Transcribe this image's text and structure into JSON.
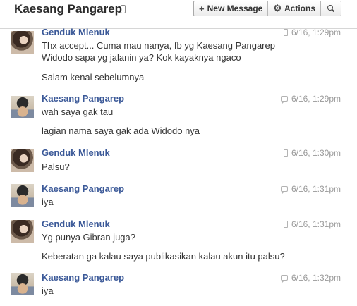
{
  "header": {
    "title": "Kaesang Pangarep",
    "new_message_label": "New Message",
    "actions_label": "Actions"
  },
  "messages": [
    {
      "author": "Genduk Mlenuk",
      "time": "6/16, 1:29pm",
      "via": "phone-icon",
      "lines": [
        "Thx accept... Cuma mau nanya, fb yg Kaesang Pangarep",
        "Widodo sapa yg jalanin ya? Kok kayaknya ngaco",
        "Salam kenal sebelumnya"
      ]
    },
    {
      "author": "Kaesang Pangarep",
      "time": "6/16, 1:29pm",
      "via": "chat-icon",
      "lines": [
        "wah saya gak tau",
        "lagian nama saya gak ada Widodo nya"
      ]
    },
    {
      "author": "Genduk Mlenuk",
      "time": "6/16, 1:30pm",
      "via": "phone-icon",
      "lines": [
        "Palsu?"
      ]
    },
    {
      "author": "Kaesang Pangarep",
      "time": "6/16, 1:31pm",
      "via": "chat-icon",
      "lines": [
        "iya"
      ]
    },
    {
      "author": "Genduk Mlenuk",
      "time": "6/16, 1:31pm",
      "via": "phone-icon",
      "lines": [
        "Yg punya Gibran juga?",
        "Keberatan ga kalau saya publikasikan kalau akun itu palsu?"
      ]
    },
    {
      "author": "Kaesang Pangarep",
      "time": "6/16, 1:32pm",
      "via": "chat-icon",
      "lines": [
        "iya"
      ]
    }
  ]
}
